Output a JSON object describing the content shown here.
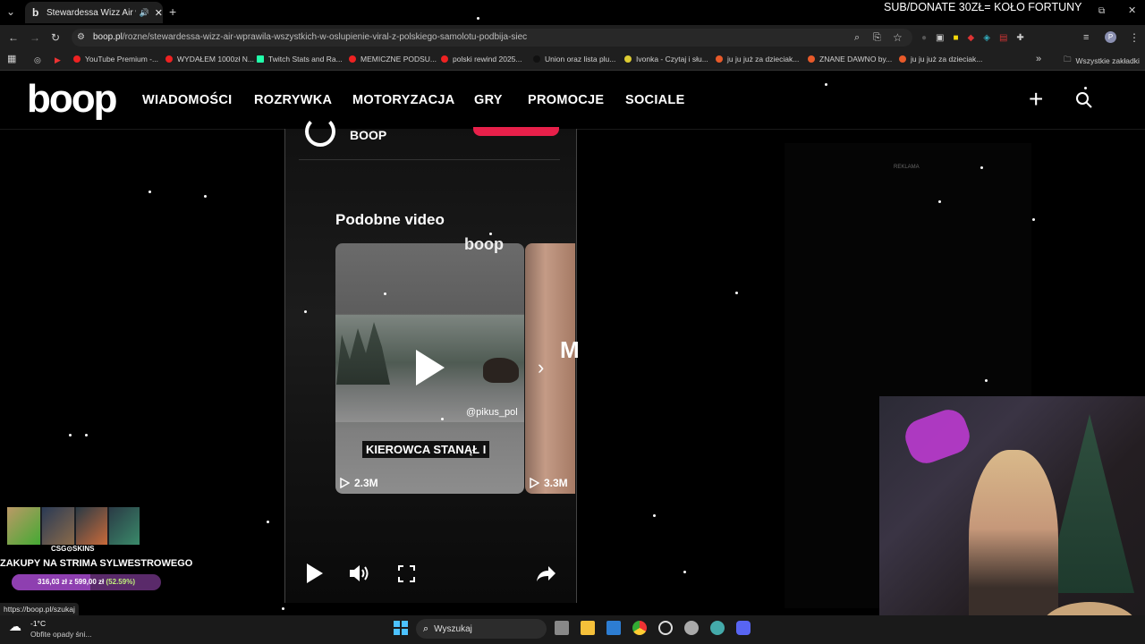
{
  "browser": {
    "tab_title": "Stewardessa Wizz Air wprawiła",
    "url_host": "boop.pl",
    "url_path": "/rozne/stewardessa-wizz-air-wprawila-wszystkich-w-oslupienie-viral-z-polskiego-samolotu-podbija-siec",
    "bookmarks": [
      "YouTube Premium -...",
      "WYDAŁEM 1000zł N...",
      "Twitch Stats and Ra...",
      "MEMICZNE PODSU...",
      "polski rewind 2025...",
      "Union oraz lista plu...",
      "Ivonka - Czytaj i słu...",
      "ju ju już za dzieciak...",
      "ZNANE DAWNO by...",
      "ju ju już za dzieciak..."
    ],
    "all_bookmarks": "Wszystkie zakładki",
    "status_url": "https://boop.pl/szukaj"
  },
  "overlay": {
    "donate_text": "SUB/DONATE 30ZŁ= KOŁO FORTUNY",
    "csgo_label": "CSG⊙SKINS",
    "promo_text": "ZAKUPY NA STRIMA SYLWESTROWEGO",
    "progress_text": "316,03 zł z 599,00 zł",
    "progress_pct_text": "(52.59%)",
    "progress_fraction": 0.5259
  },
  "site": {
    "logo": "boop",
    "nav": [
      "WIADOMOŚCI",
      "ROZRYWKA",
      "MOTORYZACJA",
      "GRY",
      "PROMOCJE",
      "SOCIALE"
    ],
    "author": "BOOP",
    "section_title": "Podobne video",
    "cards": [
      {
        "caption": "KIEROWCA STANĄŁ I",
        "handle": "@pikus_pol",
        "views": "2.3M",
        "watermark": "boop"
      },
      {
        "caption": "",
        "handle": "",
        "views": "3.3M",
        "watermark": ""
      }
    ],
    "ad_label": "REKLAMA"
  },
  "taskbar": {
    "weather_temp": "-1°C",
    "weather_desc": "Obfite opady śni...",
    "search_placeholder": "Wyszukaj"
  }
}
